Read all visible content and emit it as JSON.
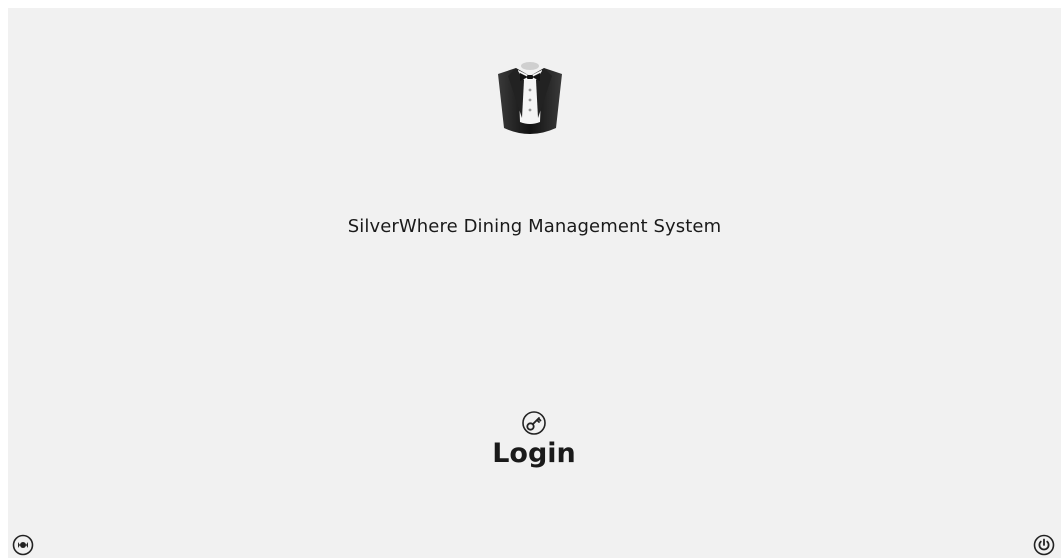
{
  "app": {
    "title": "SilverWhere Dining Management System",
    "logo_icon": "tuxedo-waiter-icon"
  },
  "login": {
    "label": "Login",
    "icon": "key-icon"
  },
  "corner_controls": {
    "left_icon": "settings-icon",
    "right_icon": "power-icon"
  },
  "colors": {
    "background": "#f1f1f1",
    "text": "#1a1a1a"
  }
}
